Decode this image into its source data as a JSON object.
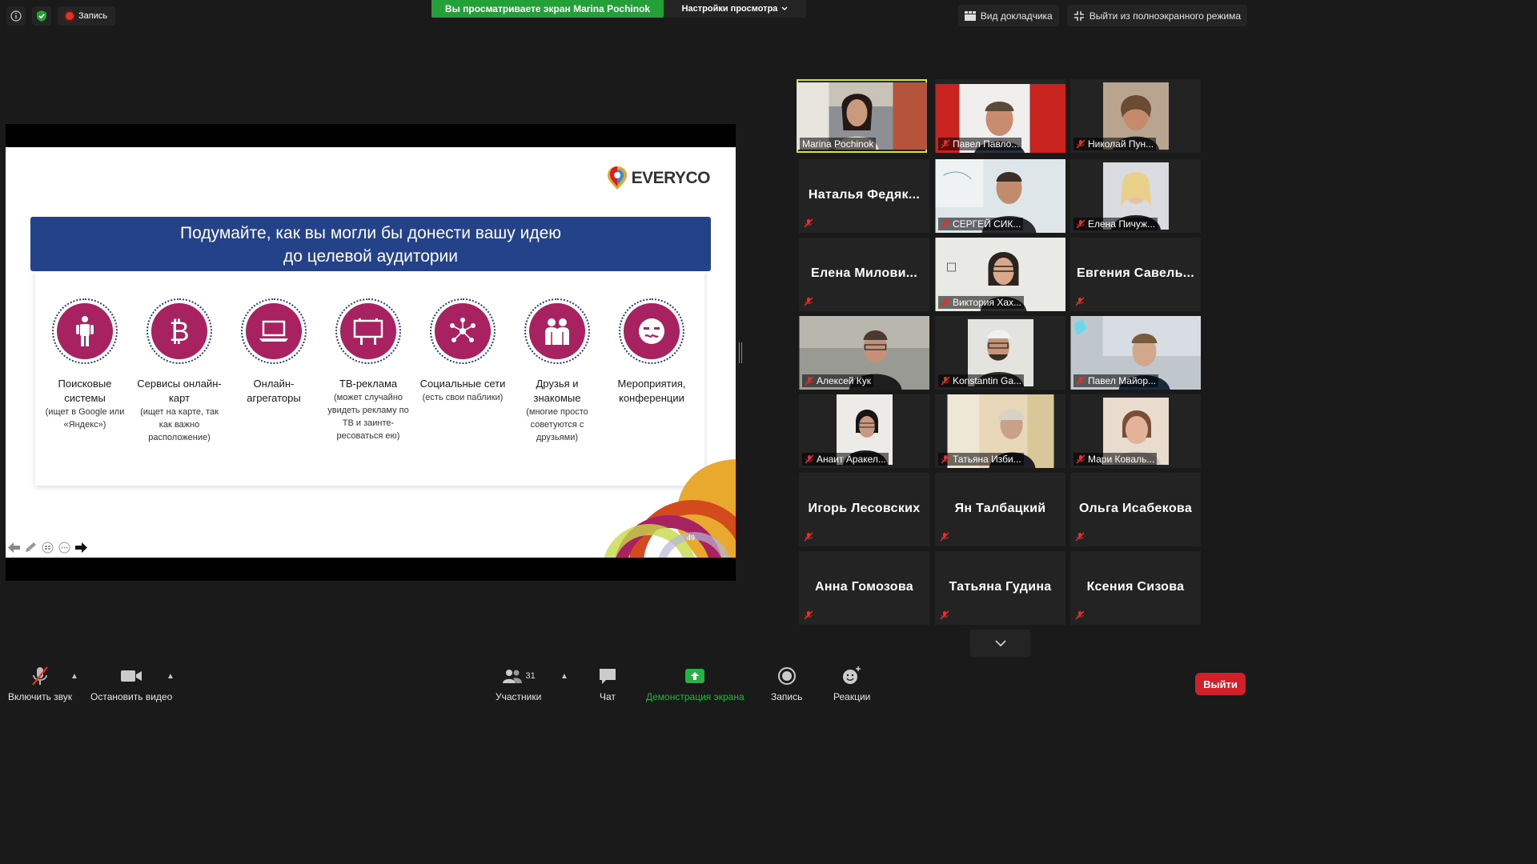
{
  "topbar": {
    "recording_label": "Запись",
    "share_banner": "Вы просматриваете экран Marina Pochinok",
    "view_settings": "Настройки просмотра",
    "speaker_view": "Вид докладчика",
    "exit_fullscreen": "Выйти из полноэкранного режима"
  },
  "slide": {
    "logo": "EVERYCO",
    "title_line1": "Подумайте, как вы могли бы донести вашу идею",
    "title_line2": "до целевой аудитории",
    "page_number": "49",
    "channels": [
      {
        "title": "Поисковые системы",
        "sub": "(ищет в Google или «Яндекс»)",
        "icon": "person-icon"
      },
      {
        "title": "Сервисы онлайн-карт",
        "sub": "(ищет на карте, так как важно расположение)",
        "icon": "bitcoin-icon"
      },
      {
        "title": "Онлайн-агрегаторы",
        "sub": "",
        "icon": "laptop-icon"
      },
      {
        "title": "ТВ-реклама",
        "sub": "(может случайно увидеть рекламу по ТВ и заинте-ресоваться ею)",
        "icon": "billboard-icon"
      },
      {
        "title": "Социальные сети",
        "sub": "(есть свои паблики)",
        "icon": "network-icon"
      },
      {
        "title": "Друзья и знакомые",
        "sub": "(многие просто советуются с друзьями)",
        "icon": "friends-icon"
      },
      {
        "title": "Мероприятия, конференции",
        "sub": "",
        "icon": "mask-icon"
      }
    ]
  },
  "participants": [
    {
      "name": "Marina Pochinok",
      "video": true,
      "active": true
    },
    {
      "name": "Павел Павло...",
      "video": true
    },
    {
      "name": "Николай Пун...",
      "video": true
    },
    {
      "name": "Наталья Федяк...",
      "video": false
    },
    {
      "name": "СЕРГЕЙ СИК...",
      "video": true
    },
    {
      "name": "Елена Пичуж...",
      "video": true
    },
    {
      "name": "Елена Милови...",
      "video": false
    },
    {
      "name": "Виктория Хах...",
      "video": true
    },
    {
      "name": "Евгения Савель...",
      "video": false
    },
    {
      "name": "Алексей Кук",
      "video": true
    },
    {
      "name": "Konstantin Ga...",
      "video": true
    },
    {
      "name": "Павел Майор...",
      "video": true
    },
    {
      "name": "Анаит Аракел...",
      "video": true
    },
    {
      "name": "Татьяна Изби...",
      "video": true
    },
    {
      "name": "Мари Коваль...",
      "video": true
    },
    {
      "name": "Игорь Лесовских",
      "video": false
    },
    {
      "name": "Ян Талбацкий",
      "video": false
    },
    {
      "name": "Ольга Исабекова",
      "video": false
    },
    {
      "name": "Анна Гомозова",
      "video": false
    },
    {
      "name": "Татьяна Гудина",
      "video": false
    },
    {
      "name": "Ксения Сизова",
      "video": false
    }
  ],
  "toolbar": {
    "unmute": "Включить звук",
    "stop_video": "Остановить видео",
    "participants": "Участники",
    "participants_count": "31",
    "chat": "Чат",
    "share_screen": "Демонстрация экрана",
    "record": "Запись",
    "reactions": "Реакции",
    "leave": "Выйти"
  },
  "colors": {
    "share_green": "#23a138",
    "slide_blue": "#234289",
    "channel_magenta": "#a82160",
    "active_speaker": "#d6e23b",
    "leave_red": "#d2202a"
  }
}
